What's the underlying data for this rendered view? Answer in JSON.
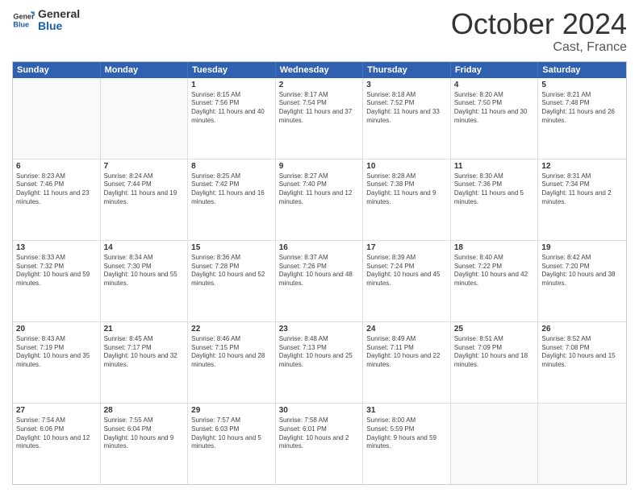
{
  "logo": {
    "line1": "General",
    "line2": "Blue"
  },
  "title": "October 2024",
  "location": "Cast, France",
  "header_days": [
    "Sunday",
    "Monday",
    "Tuesday",
    "Wednesday",
    "Thursday",
    "Friday",
    "Saturday"
  ],
  "rows": [
    [
      {
        "day": "",
        "text": ""
      },
      {
        "day": "",
        "text": ""
      },
      {
        "day": "1",
        "text": "Sunrise: 8:15 AM\nSunset: 7:56 PM\nDaylight: 11 hours and 40 minutes."
      },
      {
        "day": "2",
        "text": "Sunrise: 8:17 AM\nSunset: 7:54 PM\nDaylight: 11 hours and 37 minutes."
      },
      {
        "day": "3",
        "text": "Sunrise: 8:18 AM\nSunset: 7:52 PM\nDaylight: 11 hours and 33 minutes."
      },
      {
        "day": "4",
        "text": "Sunrise: 8:20 AM\nSunset: 7:50 PM\nDaylight: 11 hours and 30 minutes."
      },
      {
        "day": "5",
        "text": "Sunrise: 8:21 AM\nSunset: 7:48 PM\nDaylight: 11 hours and 26 minutes."
      }
    ],
    [
      {
        "day": "6",
        "text": "Sunrise: 8:23 AM\nSunset: 7:46 PM\nDaylight: 11 hours and 23 minutes."
      },
      {
        "day": "7",
        "text": "Sunrise: 8:24 AM\nSunset: 7:44 PM\nDaylight: 11 hours and 19 minutes."
      },
      {
        "day": "8",
        "text": "Sunrise: 8:25 AM\nSunset: 7:42 PM\nDaylight: 11 hours and 16 minutes."
      },
      {
        "day": "9",
        "text": "Sunrise: 8:27 AM\nSunset: 7:40 PM\nDaylight: 11 hours and 12 minutes."
      },
      {
        "day": "10",
        "text": "Sunrise: 8:28 AM\nSunset: 7:38 PM\nDaylight: 11 hours and 9 minutes."
      },
      {
        "day": "11",
        "text": "Sunrise: 8:30 AM\nSunset: 7:36 PM\nDaylight: 11 hours and 5 minutes."
      },
      {
        "day": "12",
        "text": "Sunrise: 8:31 AM\nSunset: 7:34 PM\nDaylight: 11 hours and 2 minutes."
      }
    ],
    [
      {
        "day": "13",
        "text": "Sunrise: 8:33 AM\nSunset: 7:32 PM\nDaylight: 10 hours and 59 minutes."
      },
      {
        "day": "14",
        "text": "Sunrise: 8:34 AM\nSunset: 7:30 PM\nDaylight: 10 hours and 55 minutes."
      },
      {
        "day": "15",
        "text": "Sunrise: 8:36 AM\nSunset: 7:28 PM\nDaylight: 10 hours and 52 minutes."
      },
      {
        "day": "16",
        "text": "Sunrise: 8:37 AM\nSunset: 7:26 PM\nDaylight: 10 hours and 48 minutes."
      },
      {
        "day": "17",
        "text": "Sunrise: 8:39 AM\nSunset: 7:24 PM\nDaylight: 10 hours and 45 minutes."
      },
      {
        "day": "18",
        "text": "Sunrise: 8:40 AM\nSunset: 7:22 PM\nDaylight: 10 hours and 42 minutes."
      },
      {
        "day": "19",
        "text": "Sunrise: 8:42 AM\nSunset: 7:20 PM\nDaylight: 10 hours and 38 minutes."
      }
    ],
    [
      {
        "day": "20",
        "text": "Sunrise: 8:43 AM\nSunset: 7:19 PM\nDaylight: 10 hours and 35 minutes."
      },
      {
        "day": "21",
        "text": "Sunrise: 8:45 AM\nSunset: 7:17 PM\nDaylight: 10 hours and 32 minutes."
      },
      {
        "day": "22",
        "text": "Sunrise: 8:46 AM\nSunset: 7:15 PM\nDaylight: 10 hours and 28 minutes."
      },
      {
        "day": "23",
        "text": "Sunrise: 8:48 AM\nSunset: 7:13 PM\nDaylight: 10 hours and 25 minutes."
      },
      {
        "day": "24",
        "text": "Sunrise: 8:49 AM\nSunset: 7:11 PM\nDaylight: 10 hours and 22 minutes."
      },
      {
        "day": "25",
        "text": "Sunrise: 8:51 AM\nSunset: 7:09 PM\nDaylight: 10 hours and 18 minutes."
      },
      {
        "day": "26",
        "text": "Sunrise: 8:52 AM\nSunset: 7:08 PM\nDaylight: 10 hours and 15 minutes."
      }
    ],
    [
      {
        "day": "27",
        "text": "Sunrise: 7:54 AM\nSunset: 6:06 PM\nDaylight: 10 hours and 12 minutes."
      },
      {
        "day": "28",
        "text": "Sunrise: 7:55 AM\nSunset: 6:04 PM\nDaylight: 10 hours and 9 minutes."
      },
      {
        "day": "29",
        "text": "Sunrise: 7:57 AM\nSunset: 6:03 PM\nDaylight: 10 hours and 5 minutes."
      },
      {
        "day": "30",
        "text": "Sunrise: 7:58 AM\nSunset: 6:01 PM\nDaylight: 10 hours and 2 minutes."
      },
      {
        "day": "31",
        "text": "Sunrise: 8:00 AM\nSunset: 5:59 PM\nDaylight: 9 hours and 59 minutes."
      },
      {
        "day": "",
        "text": ""
      },
      {
        "day": "",
        "text": ""
      }
    ]
  ]
}
